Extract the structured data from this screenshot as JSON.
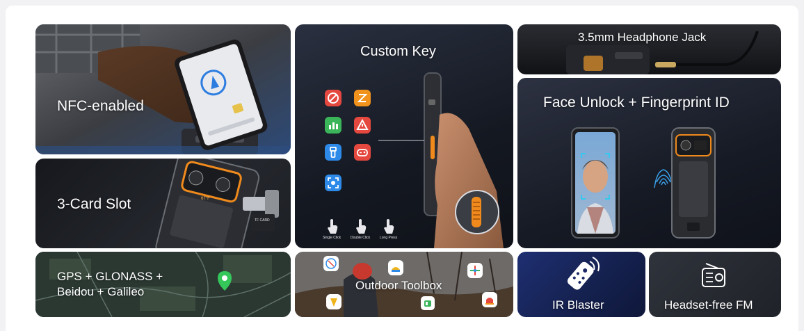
{
  "tiles": {
    "nfc": {
      "label": "NFC-enabled"
    },
    "custom_key": {
      "title": "Custom Key",
      "gestures": [
        "Single Click",
        "Double Click",
        "Long Press"
      ]
    },
    "headphone": {
      "label": "3.5mm Headphone Jack"
    },
    "face_unlock": {
      "label": "Face Unlock + Fingerprint ID"
    },
    "card_slot": {
      "label": "3-Card Slot",
      "phone_screen_text": "67°F",
      "card_text": "TF CARD"
    },
    "gps": {
      "label_line1": "GPS + GLONASS +",
      "label_line2": "Beidou + Galileo"
    },
    "toolbox": {
      "label": "Outdoor Toolbox"
    },
    "ir": {
      "label": "IR Blaster"
    },
    "fm": {
      "label": "Headset-free FM"
    }
  },
  "colors": {
    "tile_dark": "#1c1f26",
    "accent_orange": "#f08a1c",
    "red_icon": "#e5483f",
    "orange_icon": "#f0921b",
    "green_icon": "#3bb55a",
    "blue_icon": "#2d8ae8",
    "map_pin": "#35c75a",
    "ir_blue": "#1b2a66"
  },
  "icons": {
    "custom_key_apps": [
      "no-entry-icon",
      "z-icon",
      "chart-icon",
      "warning-icon",
      "flashlight-icon",
      "gamepad-icon",
      "camera-scan-icon"
    ],
    "toolbox_apps": [
      "compass-icon",
      "level-icon",
      "plumb-icon",
      "measure-icon",
      "sound-meter-icon",
      "alarm-light-icon"
    ]
  }
}
